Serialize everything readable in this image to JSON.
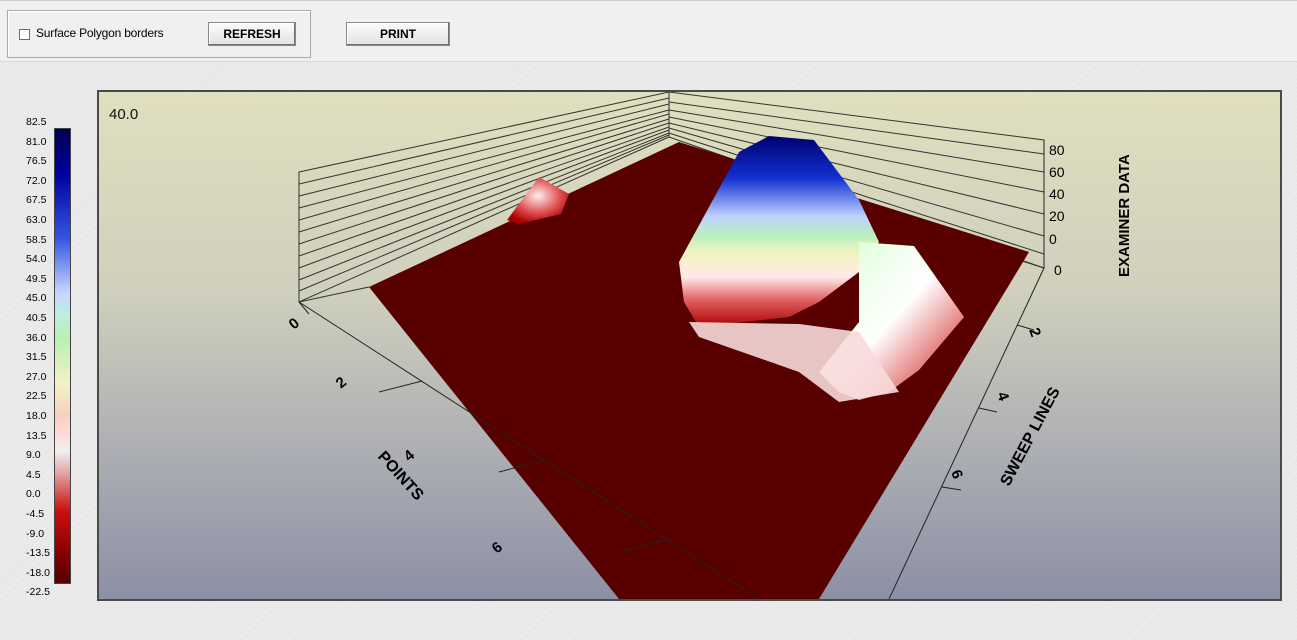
{
  "toolbar": {
    "checkbox_label": "Surface Polygon borders",
    "checkbox_checked": false,
    "refresh_label": "REFRESH",
    "print_label": "PRINT"
  },
  "legend": {
    "values": [
      "82.5",
      "81.0",
      "76.5",
      "72.0",
      "67.5",
      "63.0",
      "58.5",
      "54.0",
      "49.5",
      "45.0",
      "40.5",
      "36.0",
      "31.5",
      "27.0",
      "22.5",
      "18.0",
      "13.5",
      "9.0",
      "4.5",
      "0.0",
      "-4.5",
      "-9.0",
      "-13.5",
      "-18.0",
      "-22.5"
    ]
  },
  "plot": {
    "corner_value": "40.0",
    "z_axis_title": "EXAMINER DATA",
    "z_ticks": [
      "80",
      "60",
      "40",
      "20",
      "0",
      "0"
    ],
    "x_axis_title": "POINTS",
    "x_ticks": [
      "0",
      "2",
      "4",
      "6"
    ],
    "y_axis_title": "SWEEP LINES",
    "y_ticks": [
      "2",
      "4",
      "6"
    ],
    "floor_color": "#550000",
    "peak_color": "#00008b"
  }
}
